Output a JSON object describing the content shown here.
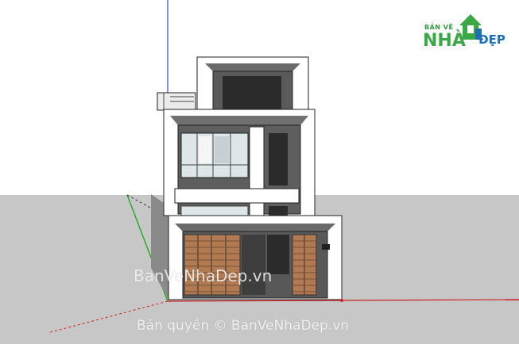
{
  "logo": {
    "top_text": "BẢN VẼ",
    "main_text": "NHÀ",
    "sub_text": "ĐẸP"
  },
  "watermark": {
    "center_text": "BanVeNhaDep.vn",
    "bottom_text": "Bản quyền © BanVeNhaDep.vn"
  },
  "colors": {
    "ground": "#c7c7c7",
    "wall_white": "#ffffff",
    "wall_dark": "#5e5e5e",
    "axis_red": "#cc2222",
    "axis_green": "#22aa22",
    "axis_blue": "#3344dd",
    "shutter_wood": "#b07a52"
  }
}
